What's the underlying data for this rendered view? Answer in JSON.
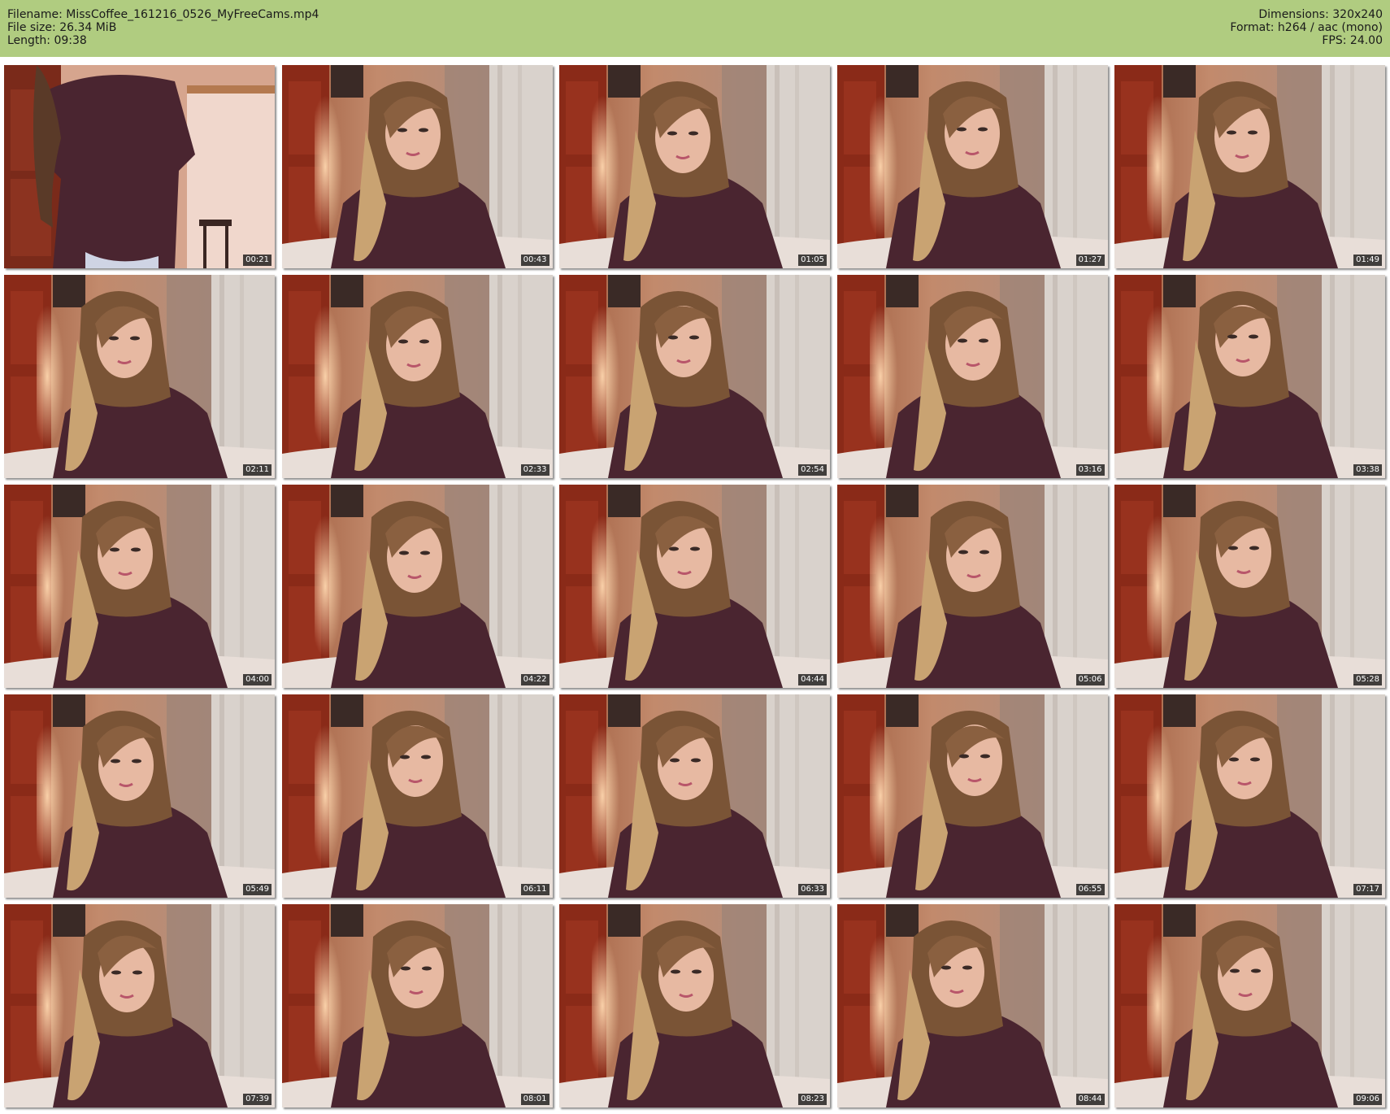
{
  "header": {
    "filename_line": "Filename: MissCoffee_161216_0526_MyFreeCams.mp4",
    "filesize_line": "File size: 26.34 MiB",
    "length_line": "Length: 09:38",
    "dimensions_line": "Dimensions: 320x240",
    "format_line": "Format: h264 / aac (mono)",
    "fps_line": "FPS: 24.00"
  },
  "colors": {
    "header_bg": "#b0cc80",
    "sweater": "#4a2530",
    "wall": "#a08078",
    "curtain": "#d9d2cc",
    "door": "#8a2a18"
  },
  "thumbnails": [
    {
      "timestamp": "00:21",
      "scene": "standing"
    },
    {
      "timestamp": "00:43",
      "scene": "seated"
    },
    {
      "timestamp": "01:05",
      "scene": "seated"
    },
    {
      "timestamp": "01:27",
      "scene": "seated"
    },
    {
      "timestamp": "01:49",
      "scene": "seated"
    },
    {
      "timestamp": "02:11",
      "scene": "seated"
    },
    {
      "timestamp": "02:33",
      "scene": "seated"
    },
    {
      "timestamp": "02:54",
      "scene": "seated"
    },
    {
      "timestamp": "03:16",
      "scene": "seated"
    },
    {
      "timestamp": "03:38",
      "scene": "seated"
    },
    {
      "timestamp": "04:00",
      "scene": "seated"
    },
    {
      "timestamp": "04:22",
      "scene": "seated"
    },
    {
      "timestamp": "04:44",
      "scene": "seated"
    },
    {
      "timestamp": "05:06",
      "scene": "seated"
    },
    {
      "timestamp": "05:28",
      "scene": "seated"
    },
    {
      "timestamp": "05:49",
      "scene": "seated"
    },
    {
      "timestamp": "06:11",
      "scene": "seated"
    },
    {
      "timestamp": "06:33",
      "scene": "seated"
    },
    {
      "timestamp": "06:55",
      "scene": "seated"
    },
    {
      "timestamp": "07:17",
      "scene": "seated"
    },
    {
      "timestamp": "07:39",
      "scene": "seated"
    },
    {
      "timestamp": "08:01",
      "scene": "seated"
    },
    {
      "timestamp": "08:23",
      "scene": "seated"
    },
    {
      "timestamp": "08:44",
      "scene": "seated"
    },
    {
      "timestamp": "09:06",
      "scene": "seated"
    }
  ]
}
